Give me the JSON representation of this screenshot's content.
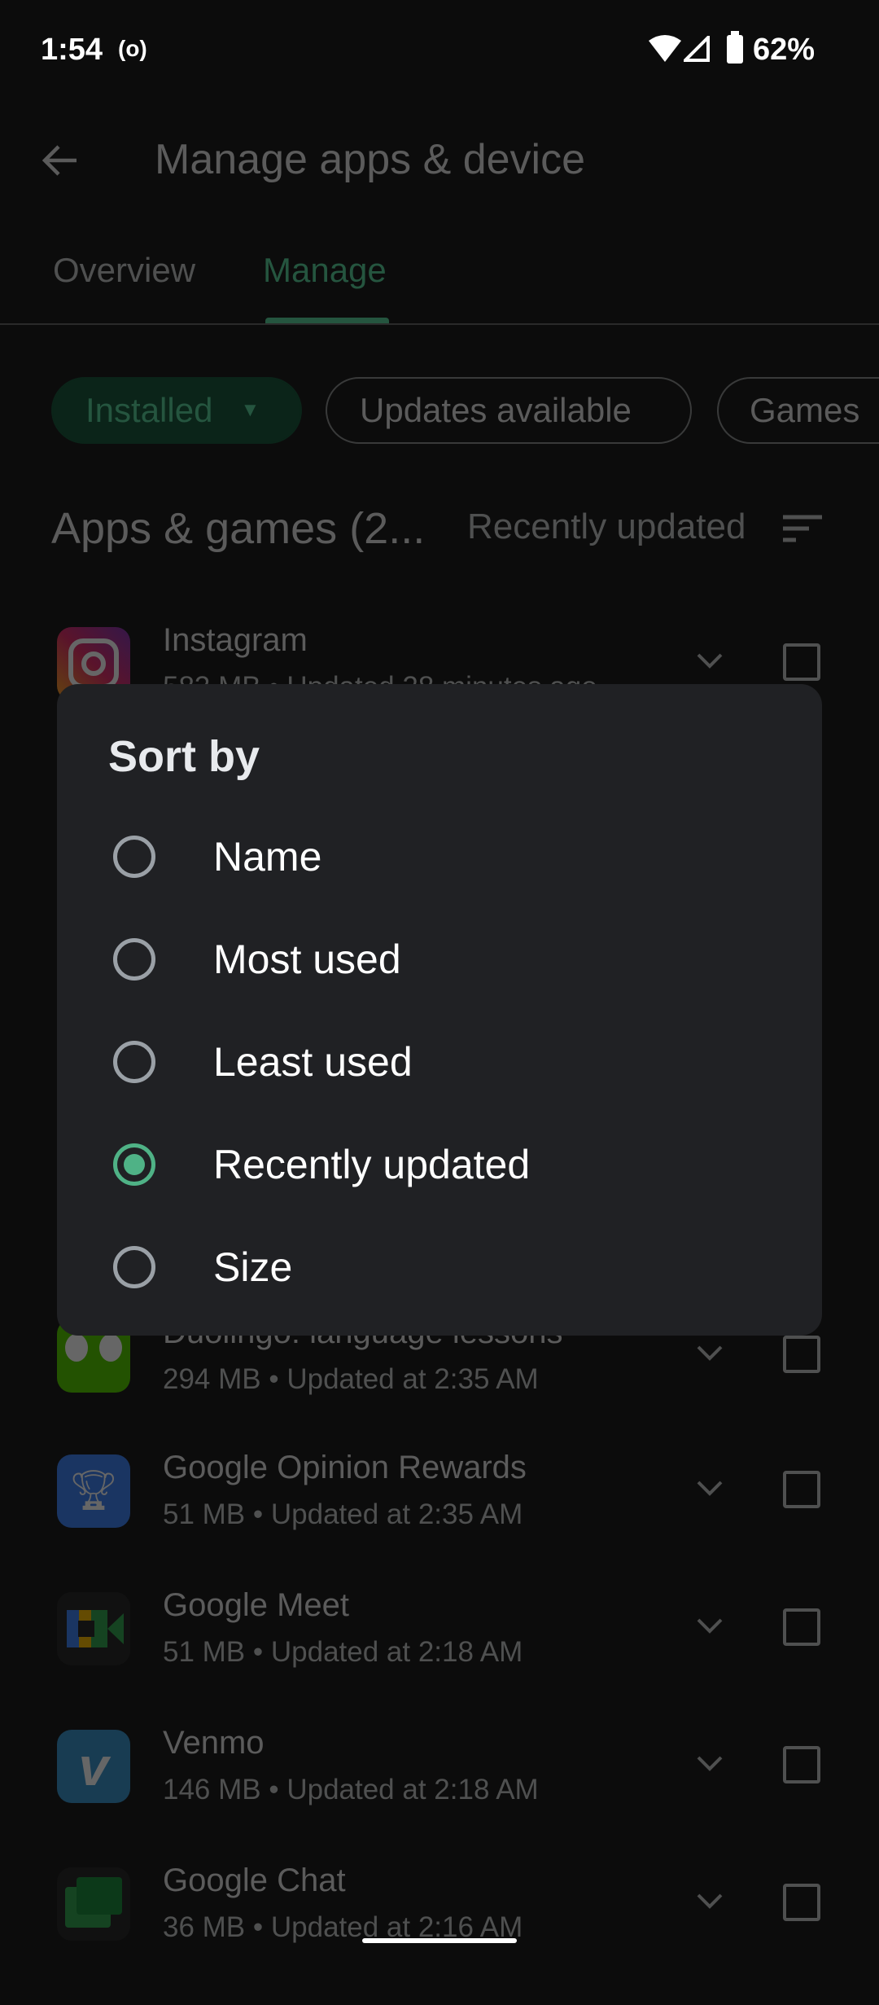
{
  "status_bar": {
    "time": "1:54",
    "battery": "62%"
  },
  "header": {
    "title": "Manage apps & device"
  },
  "tabs": [
    {
      "label": "Overview"
    },
    {
      "label": "Manage",
      "active": true
    }
  ],
  "chips": [
    {
      "label": "Installed",
      "selected": true
    },
    {
      "label": "Updates available"
    },
    {
      "label": "Games"
    }
  ],
  "list_header": {
    "title": "Apps & games (2...",
    "sort_label": "Recently updated"
  },
  "apps": [
    {
      "name": "Instagram",
      "sub": "583 MB  •  Updated 28 minutes ago",
      "icon": "instagram-icon"
    },
    {
      "name": "Duolingo: language lessons",
      "sub": "294 MB  •  Updated at 2:35 AM",
      "icon": "duolingo-icon"
    },
    {
      "name": "Google Opinion Rewards",
      "sub": "51 MB  •  Updated at 2:35 AM",
      "icon": "opinion-rewards-icon"
    },
    {
      "name": "Google Meet",
      "sub": "51 MB  •  Updated at 2:18 AM",
      "icon": "meet-icon"
    },
    {
      "name": "Venmo",
      "sub": "146 MB  •  Updated at 2:18 AM",
      "icon": "venmo-icon"
    },
    {
      "name": "Google Chat",
      "sub": "36 MB  •  Updated at 2:16 AM",
      "icon": "chat-icon"
    }
  ],
  "dialog": {
    "title": "Sort by",
    "options": [
      {
        "label": "Name",
        "selected": false
      },
      {
        "label": "Most used",
        "selected": false
      },
      {
        "label": "Least used",
        "selected": false
      },
      {
        "label": "Recently updated",
        "selected": true
      },
      {
        "label": "Size",
        "selected": false
      }
    ]
  },
  "colors": {
    "accent": "#4fb286",
    "dialog_bg": "#202124"
  }
}
